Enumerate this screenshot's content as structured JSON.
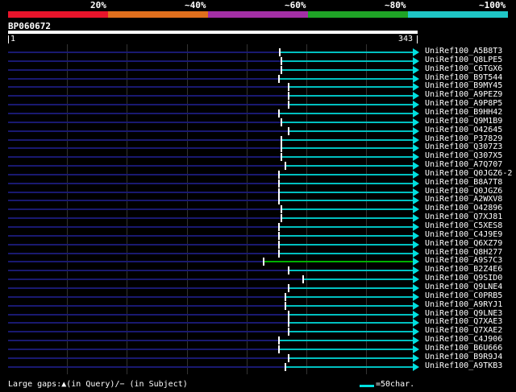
{
  "legend": {
    "labels": [
      "20%",
      "~40%",
      "~60%",
      "~80%",
      "~100%"
    ],
    "colors": [
      "#e8142b",
      "#e06f1d",
      "#a32fa5",
      "#1fa326",
      "#1fc7c7"
    ]
  },
  "query": {
    "id": "BP060672",
    "start": "1",
    "end": "343"
  },
  "hits": [
    {
      "label": "UniRef100_A5B8T3",
      "start": 347,
      "color": "cyan"
    },
    {
      "label": "UniRef100_Q8LPE5",
      "start": 349,
      "color": "cyan"
    },
    {
      "label": "UniRef100_C6TGX6",
      "start": 349,
      "color": "cyan"
    },
    {
      "label": "UniRef100_B9T544",
      "start": 346,
      "color": "cyan"
    },
    {
      "label": "UniRef100_B9MY45",
      "start": 358,
      "color": "cyan"
    },
    {
      "label": "UniRef100_A9PEZ9",
      "start": 358,
      "color": "cyan"
    },
    {
      "label": "UniRef100_A9P8P5",
      "start": 358,
      "color": "cyan"
    },
    {
      "label": "UniRef100_B9HH42",
      "start": 346,
      "color": "cyan"
    },
    {
      "label": "UniRef100_Q9M1B9",
      "start": 349,
      "color": "cyan"
    },
    {
      "label": "UniRef100_O42645",
      "start": 358,
      "color": "cyan"
    },
    {
      "label": "UniRef100_P37829",
      "start": 349,
      "color": "cyan"
    },
    {
      "label": "UniRef100_Q307Z3",
      "start": 349,
      "color": "cyan"
    },
    {
      "label": "UniRef100_Q307X5",
      "start": 349,
      "color": "cyan"
    },
    {
      "label": "UniRef100_A7Q707",
      "start": 354,
      "color": "cyan"
    },
    {
      "label": "UniRef100_Q0JGZ6-2",
      "start": 346,
      "color": "cyan"
    },
    {
      "label": "UniRef100_B8A7T8",
      "start": 346,
      "color": "cyan"
    },
    {
      "label": "UniRef100_Q0JGZ6",
      "start": 346,
      "color": "cyan"
    },
    {
      "label": "UniRef100_A2WXV8",
      "start": 346,
      "color": "cyan"
    },
    {
      "label": "UniRef100_O42896",
      "start": 349,
      "color": "cyan"
    },
    {
      "label": "UniRef100_Q7XJ81",
      "start": 349,
      "color": "cyan"
    },
    {
      "label": "UniRef100_C5XES8",
      "start": 346,
      "color": "cyan"
    },
    {
      "label": "UniRef100_C4J9E9",
      "start": 346,
      "color": "cyan"
    },
    {
      "label": "UniRef100_Q6XZ79",
      "start": 346,
      "color": "cyan"
    },
    {
      "label": "UniRef100_Q8H277",
      "start": 346,
      "color": "cyan"
    },
    {
      "label": "UniRef100_A9S7C3",
      "start": 327,
      "color": "green"
    },
    {
      "label": "UniRef100_B2Z4E6",
      "start": 358,
      "color": "cyan"
    },
    {
      "label": "UniRef100_Q9SID0",
      "start": 376,
      "color": "cyan"
    },
    {
      "label": "UniRef100_Q9LNE4",
      "start": 358,
      "color": "cyan"
    },
    {
      "label": "UniRef100_C0PRB5",
      "start": 354,
      "color": "cyan"
    },
    {
      "label": "UniRef100_A9RYJ1",
      "start": 354,
      "color": "cyan"
    },
    {
      "label": "UniRef100_Q9LNE3",
      "start": 358,
      "color": "cyan"
    },
    {
      "label": "UniRef100_Q7XAE3",
      "start": 358,
      "color": "cyan"
    },
    {
      "label": "UniRef100_Q7XAE2",
      "start": 358,
      "color": "cyan"
    },
    {
      "label": "UniRef100_C4J906",
      "start": 346,
      "color": "cyan"
    },
    {
      "label": "UniRef100_B6U666",
      "start": 346,
      "color": "cyan"
    },
    {
      "label": "UniRef100_B9R9J4",
      "start": 358,
      "color": "cyan"
    },
    {
      "label": "UniRef100_A9TKB3",
      "start": 354,
      "color": "cyan"
    }
  ],
  "footer": {
    "gaps_text": "Large gaps:▲(in Query)/− (in Subject)",
    "scale_text": "=50char."
  }
}
